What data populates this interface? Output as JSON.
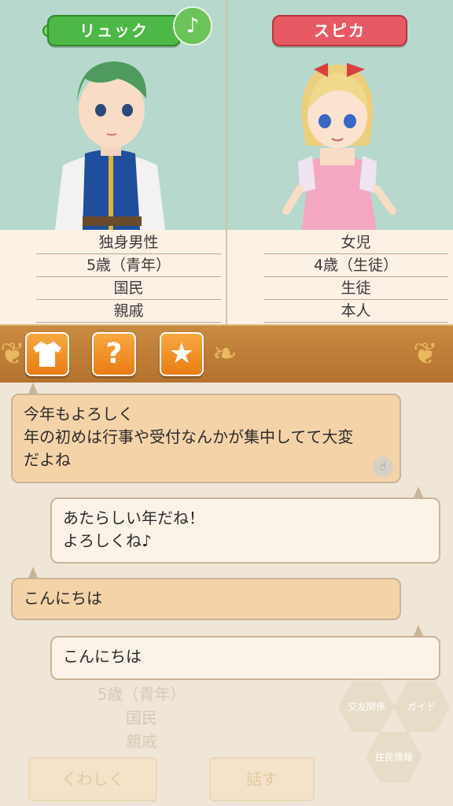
{
  "left_character": {
    "name": "リュック",
    "note_icon": "♪",
    "info": [
      "独身男性",
      "5歳（青年）",
      "国民",
      "親戚"
    ]
  },
  "right_character": {
    "name": "スピカ",
    "info": [
      "女児",
      "4歳（生徒）",
      "生徒",
      "本人"
    ]
  },
  "icon_bar": {
    "buttons": [
      "shirt-icon",
      "question-icon",
      "star-icon"
    ],
    "question_glyph": "?",
    "star_glyph": "★"
  },
  "chat": {
    "messages": [
      {
        "side": "left",
        "lines": [
          "今年もよろしく",
          "年の初めは行事や受付なんかが集中してて大変",
          "だよね"
        ]
      },
      {
        "side": "right",
        "lines": [
          "あたらしい年だね！",
          "よろしくね♪"
        ]
      },
      {
        "side": "left",
        "lines": [
          "こんにちは"
        ]
      },
      {
        "side": "right",
        "lines": [
          "こんにちは"
        ]
      }
    ]
  },
  "background": {
    "info_lines": [
      "5歳（青年）",
      "国民",
      "親戚"
    ],
    "details_button": "くわしく",
    "talk_button": "話す",
    "hex_labels": [
      "交友関係",
      "ガイド",
      "住民情報"
    ]
  }
}
